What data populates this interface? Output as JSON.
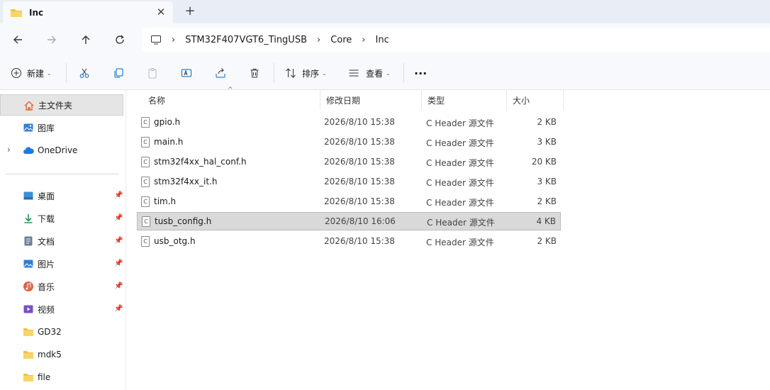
{
  "tab": {
    "title": "Inc",
    "close": "✕",
    "new_tab": "+"
  },
  "breadcrumb": [
    "STM32F407VGT6_TingUSB",
    "Core",
    "Inc"
  ],
  "toolbar": {
    "new_label": "新建",
    "sort_label": "排序",
    "view_label": "查看",
    "more": "···"
  },
  "sidebar": {
    "home": "主文件夹",
    "gallery": "图库",
    "onedrive": "OneDrive",
    "quick": [
      {
        "label": "桌面",
        "icon": "desktop-icon"
      },
      {
        "label": "下载",
        "icon": "download-icon"
      },
      {
        "label": "文档",
        "icon": "document-icon"
      },
      {
        "label": "图片",
        "icon": "pictures-icon"
      },
      {
        "label": "音乐",
        "icon": "music-icon"
      },
      {
        "label": "视频",
        "icon": "video-icon"
      },
      {
        "label": "GD32",
        "icon": "folder-icon"
      },
      {
        "label": "mdk5",
        "icon": "folder-icon"
      },
      {
        "label": "file",
        "icon": "folder-icon"
      }
    ]
  },
  "columns": {
    "name": "名称",
    "date": "修改日期",
    "type": "类型",
    "size": "大小"
  },
  "files": [
    {
      "name": "gpio.h",
      "date": "2026/8/10 15:38",
      "type": "C Header 源文件",
      "size": "2 KB"
    },
    {
      "name": "main.h",
      "date": "2026/8/10 15:38",
      "type": "C Header 源文件",
      "size": "3 KB"
    },
    {
      "name": "stm32f4xx_hal_conf.h",
      "date": "2026/8/10 15:38",
      "type": "C Header 源文件",
      "size": "20 KB"
    },
    {
      "name": "stm32f4xx_it.h",
      "date": "2026/8/10 15:38",
      "type": "C Header 源文件",
      "size": "3 KB"
    },
    {
      "name": "tim.h",
      "date": "2026/8/10 15:38",
      "type": "C Header 源文件",
      "size": "2 KB"
    },
    {
      "name": "tusb_config.h",
      "date": "2026/8/10 16:06",
      "type": "C Header 源文件",
      "size": "4 KB"
    },
    {
      "name": "usb_otg.h",
      "date": "2026/8/10 15:38",
      "type": "C Header 源文件",
      "size": "2 KB"
    }
  ],
  "selected_file": "tusb_config.h",
  "colors": {
    "accent": "#0067c0",
    "folder": "#f4c13e",
    "selection": "#d9d9d9",
    "chrome": "#f7f9fc"
  }
}
